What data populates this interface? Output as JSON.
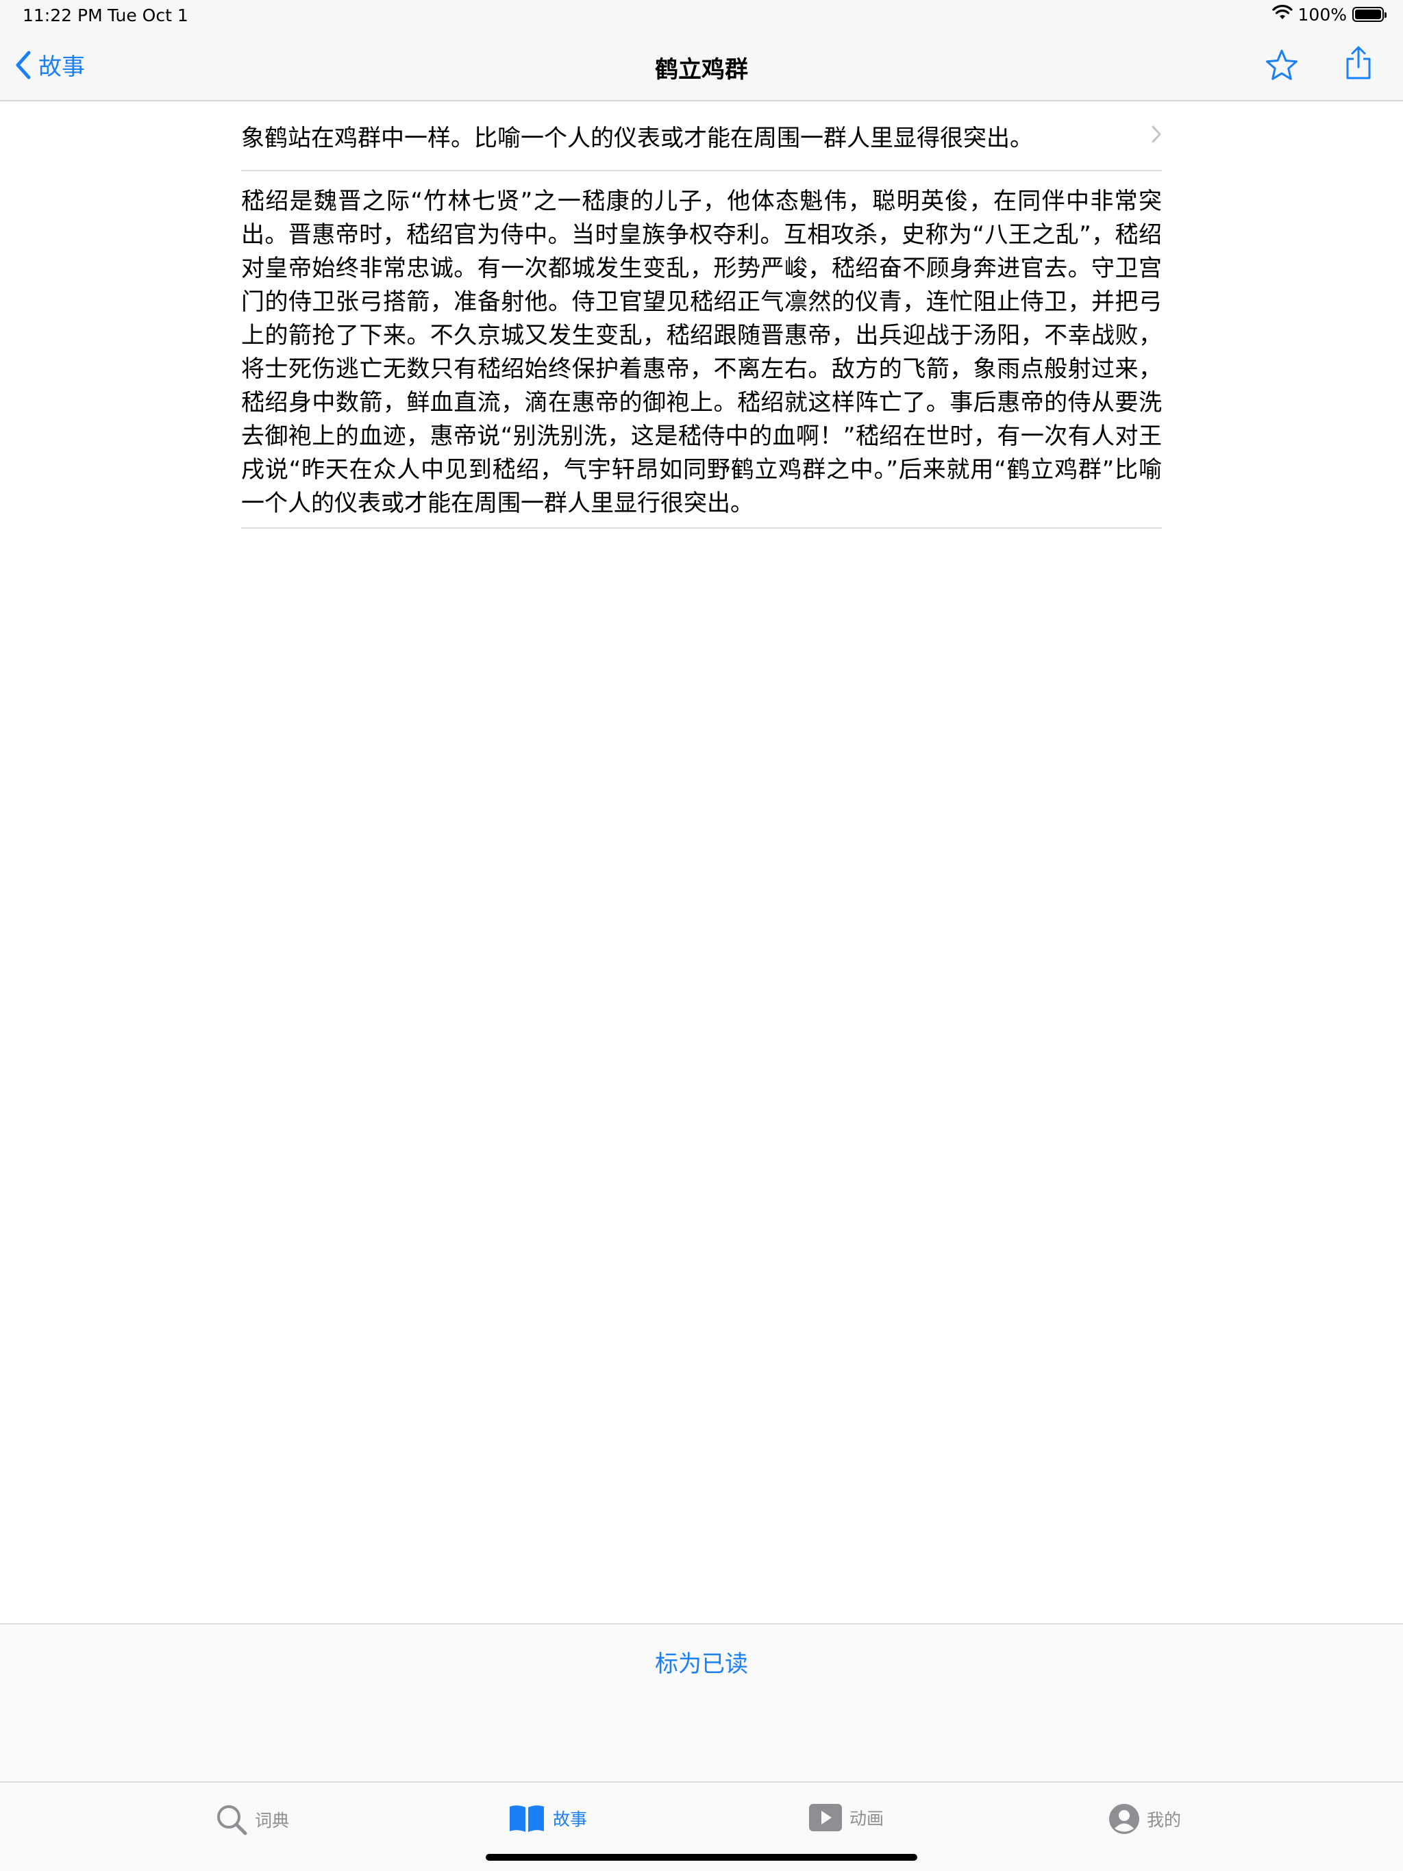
{
  "status_bar": {
    "time": "11:22 PM",
    "date": "Tue Oct 1",
    "battery": "100%",
    "icons": [
      "wifi-icon",
      "battery-icon"
    ]
  },
  "nav": {
    "back_label": "故事",
    "title": "鹤立鸡群",
    "icons": [
      "back-chevron-icon",
      "star-icon",
      "share-icon"
    ]
  },
  "summary": {
    "text": "象鹤站在鸡群中一样。比喻一个人的仪表或才能在周围一群人里显得很突出。"
  },
  "story": {
    "text": "嵇绍是魏晋之际“竹林七贤”之一嵇康的儿子，他体态魁伟，聪明英俊，在同伴中非常突出。晋惠帝时，嵇绍官为侍中。当时皇族争权夺利。互相攻杀，史称为“八王之乱”，嵇绍对皇帝始终非常忠诚。有一次都城发生变乱，形势严峻，嵇绍奋不顾身奔进官去。守卫宫门的侍卫张弓搭箭，准备射他。侍卫官望见嵇绍正气凛然的仪青，连忙阻止侍卫，并把弓上的箭抢了下来。不久京城又发生变乱，嵇绍跟随晋惠帝，出兵迎战于汤阳，不幸战败，将士死伤逃亡无数只有嵇绍始终保护着惠帝，不离左右。敌方的飞箭，象雨点般射过来，嵇绍身中数箭，鲜血直流，滴在惠帝的御袍上。嵇绍就这样阵亡了。事后惠帝的侍从要洗去御袍上的血迹，惠帝说“别洗别洗，这是嵇侍中的血啊！”嵇绍在世时，有一次有人对王戌说“昨天在众人中见到嵇绍，气宇轩昂如同野鹤立鸡群之中。”后来就用“鹤立鸡群”比喻一个人的仪表或才能在周围一群人里显行很突出。"
  },
  "actions": {
    "mark_read": "标为已读"
  },
  "tabs": [
    {
      "label": "词典",
      "icon": "search-icon",
      "active": false
    },
    {
      "label": "故事",
      "icon": "book-icon",
      "active": true
    },
    {
      "label": "动画",
      "icon": "play-icon",
      "active": false
    },
    {
      "label": "我的",
      "icon": "person-icon",
      "active": false
    }
  ],
  "colors": {
    "accent": "#1b7ff5",
    "inactive": "#8e8e93",
    "bar_background": "#f7f7f7",
    "separator": "#dcdcdc"
  }
}
